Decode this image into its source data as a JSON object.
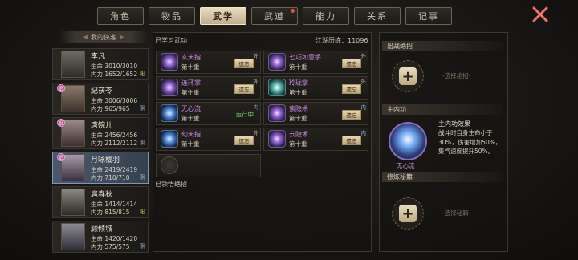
{
  "tabs": [
    {
      "label": "角色",
      "active": false,
      "dot": false
    },
    {
      "label": "物品",
      "active": false,
      "dot": false
    },
    {
      "label": "武学",
      "active": true,
      "dot": false
    },
    {
      "label": "武道",
      "active": false,
      "dot": true
    },
    {
      "label": "能力",
      "active": false,
      "dot": false
    },
    {
      "label": "关系",
      "active": false,
      "dot": false
    },
    {
      "label": "记事",
      "active": false,
      "dot": false
    }
  ],
  "colors": {
    "accent_active_tab": "#e8dcbf",
    "selected_hero": "#4a5a6c",
    "skill_name": "#c98be6",
    "running": "#7ccf74",
    "close": "#d9534f"
  },
  "hero_list": {
    "title": "我的侠客",
    "heroes": [
      {
        "name": "李凡",
        "hp": "生命 3010/3010",
        "mp": "内力 1652/1652",
        "affinity": "阳",
        "badge": "",
        "selected": false
      },
      {
        "name": "紀茯苓",
        "hp": "生命 3006/3006",
        "mp": "内力 965/965",
        "affinity": "阴",
        "badge": "侣",
        "selected": false
      },
      {
        "name": "唐婉儿",
        "hp": "生命 2456/2456",
        "mp": "内力 2112/2112",
        "affinity": "阴",
        "badge": "侣",
        "selected": false
      },
      {
        "name": "月咏樱羽",
        "hp": "生命 2419/2419",
        "mp": "内力 710/710",
        "affinity": "阴",
        "badge": "侣",
        "selected": true
      },
      {
        "name": "扈春秋",
        "hp": "生命 1414/1414",
        "mp": "内力 815/815",
        "affinity": "阳",
        "badge": "",
        "selected": false
      },
      {
        "name": "顾倾城",
        "hp": "生命 1420/1420",
        "mp": "内力 575/575",
        "affinity": "阴",
        "badge": "",
        "selected": false
      }
    ]
  },
  "learned": {
    "title": "已学习武功",
    "experience": "江湖历练：11096",
    "skills": [
      {
        "name": "玄天指",
        "level": "第十重",
        "action": "遗忘",
        "tag": "外",
        "icon": "finger-strike-icon",
        "running": ""
      },
      {
        "name": "七巧如意手",
        "level": "第十重",
        "action": "遗忘",
        "tag": "外",
        "icon": "seven-hands-icon",
        "running": ""
      },
      {
        "name": "连环掌",
        "level": "第十重",
        "action": "遗忘",
        "tag": "外",
        "icon": "palm-chain-icon",
        "running": ""
      },
      {
        "name": "玲珑掌",
        "level": "第十重",
        "action": "遗忘",
        "tag": "外",
        "icon": "jade-palm-icon",
        "running": ""
      },
      {
        "name": "无心流",
        "level": "第十重",
        "action": "",
        "tag": "内",
        "icon": "blue-flame-icon",
        "running": "运行中"
      },
      {
        "name": "紫隐术",
        "level": "第十重",
        "action": "遗忘",
        "tag": "内",
        "icon": "purple-shadow-icon",
        "running": ""
      },
      {
        "name": "幻天指",
        "level": "第十重",
        "action": "遗忘",
        "tag": "外",
        "icon": "phantom-finger-icon",
        "running": ""
      },
      {
        "name": "云隐术",
        "level": "第十重",
        "action": "遗忘",
        "tag": "内",
        "icon": "cloud-hide-icon",
        "running": ""
      }
    ],
    "understood_title": "已领悟绝招"
  },
  "right": {
    "combat_title": "出战绝招",
    "combat_hint": "-选择绝招-",
    "inner_title": "主内功",
    "inner_name": "无心流",
    "effect_title": "主内功效果",
    "effect_text": "战斗时自身生命小于30%，伤害增加50%，集气速度提升50%。",
    "training_title": "修炼秘籍",
    "training_hint": "-选择秘籍-"
  }
}
